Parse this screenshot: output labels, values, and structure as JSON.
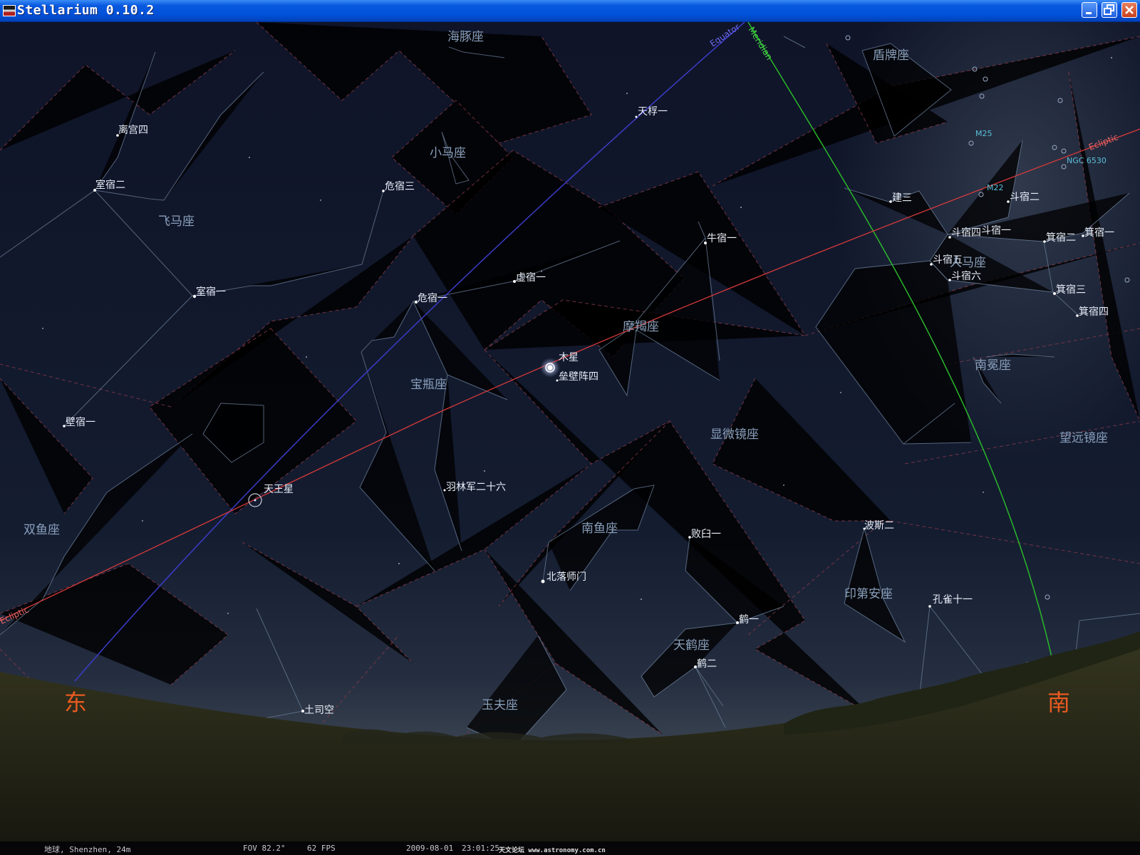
{
  "window": {
    "title": "Stellarium 0.10.2"
  },
  "colors": {
    "sky_top": "#0f1428",
    "sky_horizon": "#3c4652",
    "ground": "#2a2a18",
    "ecliptic": "#d83a3a",
    "equator": "#3c3cc8",
    "meridian": "#2ab82a",
    "cardinal": "#e85a20",
    "constellation_line": "#6a7e98",
    "boundary": "#8a3a48"
  },
  "sky_lines": {
    "equator_label": "Equator",
    "meridian_label": "Meridian",
    "ecliptic_label_east": "Ecliptic",
    "ecliptic_label_south": "Ecliptic"
  },
  "cardinals": {
    "east": "东",
    "south": "南"
  },
  "constellations": [
    {
      "id": "delphinus",
      "name": "海豚座"
    },
    {
      "id": "scutum",
      "name": "盾牌座"
    },
    {
      "id": "equuleus",
      "name": "小马座"
    },
    {
      "id": "pegasus",
      "name": "飞马座"
    },
    {
      "id": "sagittarius",
      "name": "人马座"
    },
    {
      "id": "capricornus",
      "name": "摩羯座"
    },
    {
      "id": "aquarius",
      "name": "宝瓶座"
    },
    {
      "id": "corona-australis",
      "name": "南冕座"
    },
    {
      "id": "microscopium",
      "name": "显微镜座"
    },
    {
      "id": "telescopium",
      "name": "望远镜座"
    },
    {
      "id": "pisces",
      "name": "双鱼座"
    },
    {
      "id": "piscis-austrinus",
      "name": "南鱼座"
    },
    {
      "id": "indus",
      "name": "印第安座"
    },
    {
      "id": "grus",
      "name": "天鹤座"
    },
    {
      "id": "sculptor",
      "name": "玉夫座"
    }
  ],
  "stars": [
    {
      "id": "lisong4",
      "name": "离宫四"
    },
    {
      "id": "shisu2",
      "name": "室宿二"
    },
    {
      "id": "weisu3",
      "name": "危宿三"
    },
    {
      "id": "tianfu1",
      "name": "天桴一"
    },
    {
      "id": "jian3",
      "name": "建三"
    },
    {
      "id": "dousu2",
      "name": "斗宿二"
    },
    {
      "id": "dousu4",
      "name": "斗宿四"
    },
    {
      "id": "dousu1",
      "name": "斗宿一"
    },
    {
      "id": "jisu2",
      "name": "箕宿二"
    },
    {
      "id": "jisu1",
      "name": "箕宿一"
    },
    {
      "id": "niusu1",
      "name": "牛宿一"
    },
    {
      "id": "dousu5",
      "name": "斗宿五"
    },
    {
      "id": "dousu6",
      "name": "斗宿六"
    },
    {
      "id": "xusu1",
      "name": "虚宿一"
    },
    {
      "id": "shisu1",
      "name": "室宿一"
    },
    {
      "id": "weisu1",
      "name": "危宿一"
    },
    {
      "id": "jisu3",
      "name": "箕宿三"
    },
    {
      "id": "jisu4",
      "name": "箕宿四"
    },
    {
      "id": "leibizhen4",
      "name": "垒壁阵四"
    },
    {
      "id": "bisu1",
      "name": "壁宿一"
    },
    {
      "id": "yulinjun26",
      "name": "羽林军二十六"
    },
    {
      "id": "bosi2",
      "name": "波斯二"
    },
    {
      "id": "bairi1",
      "name": "败臼一"
    },
    {
      "id": "beiluoshimen",
      "name": "北落师门"
    },
    {
      "id": "kongque11",
      "name": "孔雀十一"
    },
    {
      "id": "he1",
      "name": "鹤一"
    },
    {
      "id": "he2",
      "name": "鹤二"
    },
    {
      "id": "tusikong",
      "name": "土司空"
    },
    {
      "id": "kongque-partial",
      "name": "孔雀"
    }
  ],
  "planets": [
    {
      "id": "jupiter",
      "name": "木星"
    },
    {
      "id": "uranus",
      "name": "天王星"
    }
  ],
  "deep_sky": [
    {
      "id": "m25",
      "name": "M25"
    },
    {
      "id": "m22",
      "name": "M22"
    },
    {
      "id": "ngc6530",
      "name": "NGC 6530"
    }
  ],
  "status": {
    "location": "地球, Shenzhen, 24m",
    "fov": "FOV 82.2°",
    "fps": "62 FPS",
    "date": "2009-08-01",
    "time": "23:01:25",
    "watermark": "天文论坛 www.astronomy.com.cn"
  }
}
